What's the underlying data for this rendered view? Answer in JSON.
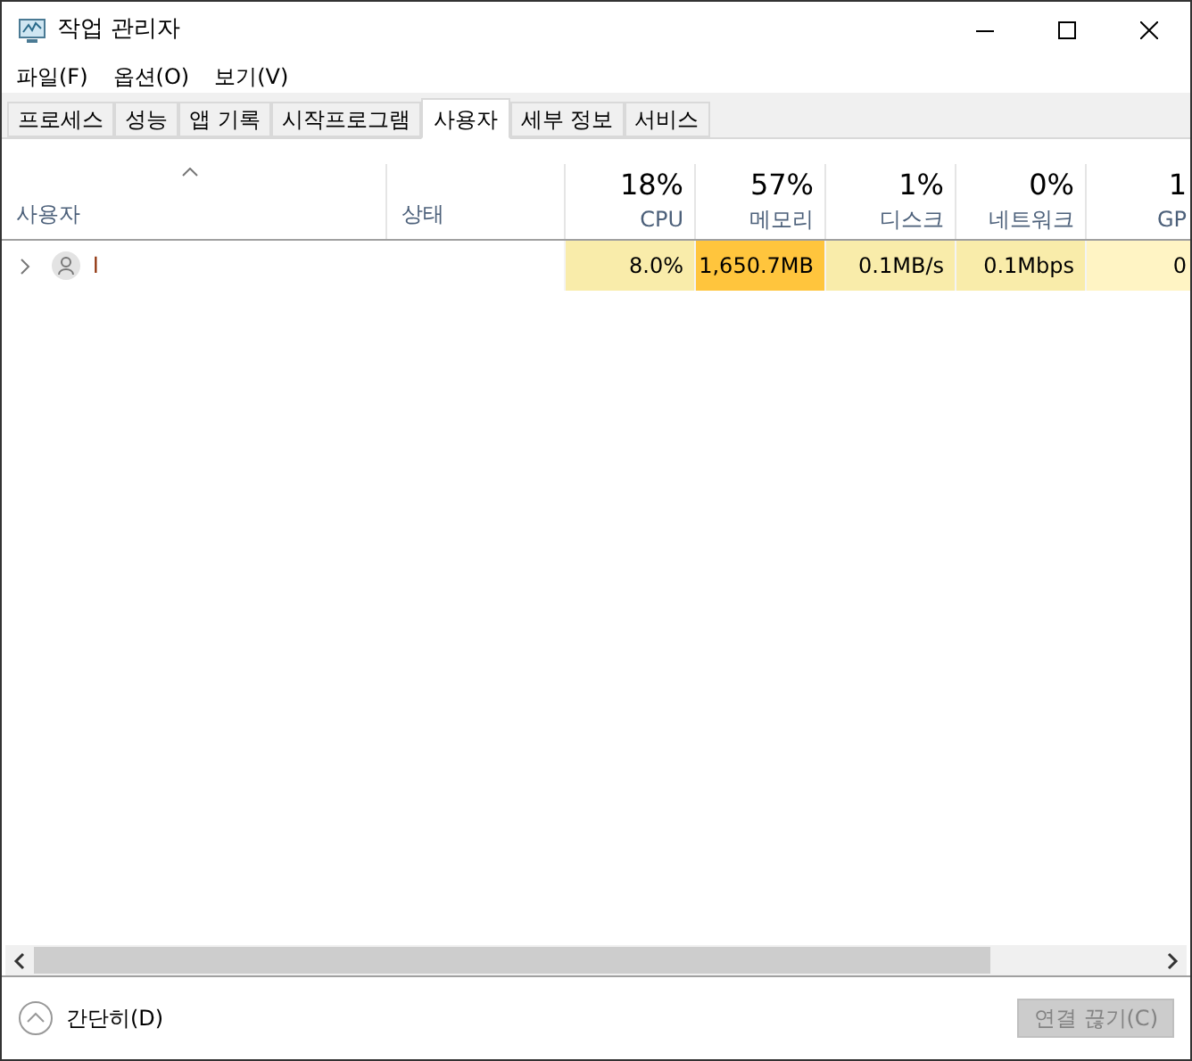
{
  "window": {
    "title": "작업 관리자"
  },
  "menu": [
    "파일(F)",
    "옵션(O)",
    "보기(V)"
  ],
  "tabs": [
    {
      "label": "프로세스",
      "selected": false
    },
    {
      "label": "성능",
      "selected": false
    },
    {
      "label": "앱 기록",
      "selected": false
    },
    {
      "label": "시작프로그램",
      "selected": false
    },
    {
      "label": "사용자",
      "selected": true
    },
    {
      "label": "세부 정보",
      "selected": false
    },
    {
      "label": "서비스",
      "selected": false
    }
  ],
  "table": {
    "columns": [
      {
        "label": "사용자",
        "kind": "name",
        "sorted": true
      },
      {
        "label": "상태",
        "kind": "text",
        "sorted": false
      },
      {
        "percent": "18%",
        "label": "CPU",
        "kind": "metric",
        "sorted": false
      },
      {
        "percent": "57%",
        "label": "메모리",
        "kind": "metric",
        "sorted": false
      },
      {
        "percent": "1%",
        "label": "디스크",
        "kind": "metric",
        "sorted": false
      },
      {
        "percent": "0%",
        "label": "네트워크",
        "kind": "metric",
        "sorted": false
      },
      {
        "percent": "1",
        "label": "GP",
        "kind": "cut",
        "sorted": false
      }
    ],
    "rows": [
      {
        "expanded": false,
        "cells": [
          {
            "value": "l"
          },
          {},
          {
            "value": "8.0%",
            "color": "#f9ecaa"
          },
          {
            "value": "1,650.7MB",
            "color": "#ffc53d"
          },
          {
            "value": "0.1MB/s",
            "color": "#f9ecaa"
          },
          {
            "value": "0.1Mbps",
            "color": "#f9ecaa"
          },
          {
            "value": "0",
            "color": "#fff4c4"
          }
        ]
      }
    ]
  },
  "footer": {
    "collapse": "간단히(D)",
    "button": {
      "label": "연결 끊기(C)",
      "disabled": true
    }
  }
}
